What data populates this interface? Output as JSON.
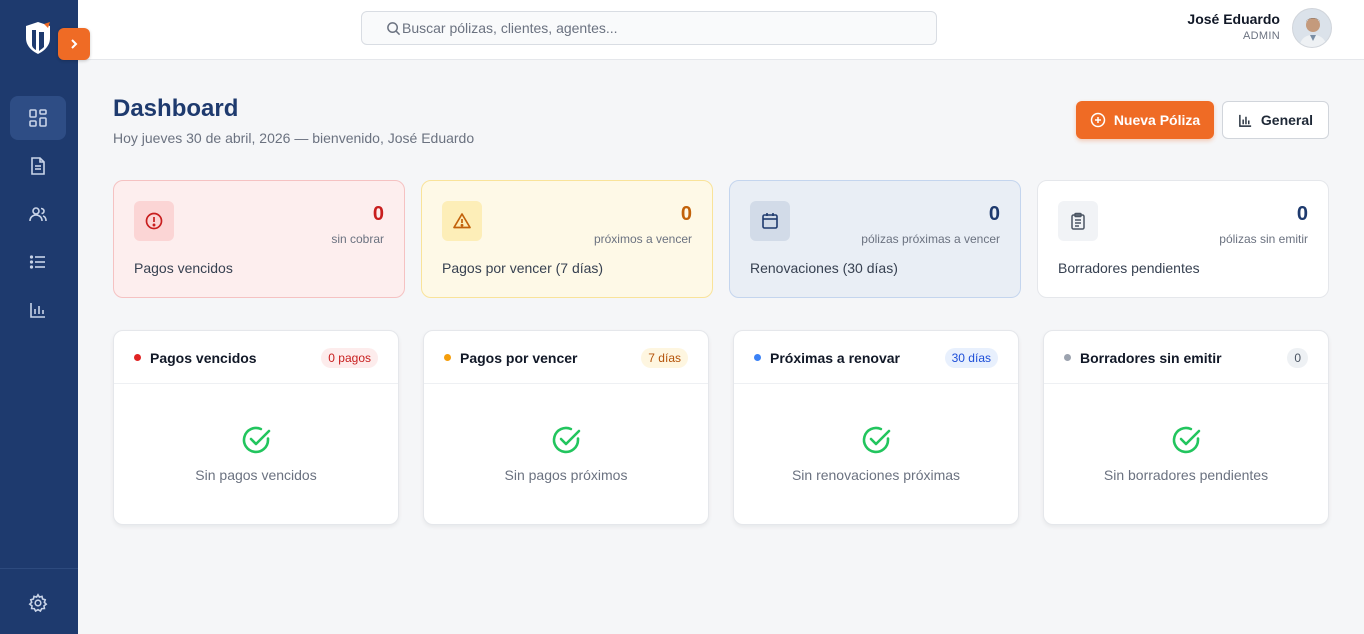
{
  "sidebar": {
    "logo": "shield-logo",
    "items": [
      {
        "icon": "dashboard-grid-icon",
        "active": true
      },
      {
        "icon": "document-icon",
        "active": false
      },
      {
        "icon": "users-icon",
        "active": false
      },
      {
        "icon": "list-icon",
        "active": false
      },
      {
        "icon": "bar-chart-icon",
        "active": false
      }
    ],
    "footer_icon": "gear-icon"
  },
  "header": {
    "search_placeholder": "Buscar pólizas, clientes, agentes...",
    "user_name": "José Eduardo",
    "user_role": "ADMIN"
  },
  "page": {
    "title": "Dashboard",
    "subtitle": "Hoy jueves 30 de abril, 2026 — bienvenido, José Eduardo",
    "primary_button": "Nueva Póliza",
    "secondary_button": "General"
  },
  "stats": [
    {
      "value": "0",
      "sub": "sin cobrar",
      "label": "Pagos vencidos",
      "color": "#c81e1e"
    },
    {
      "value": "0",
      "sub": "próximos a vencer",
      "label": "Pagos por vencer (7 días)",
      "color": "#c2620a"
    },
    {
      "value": "0",
      "sub": "pólizas próximas a vencer",
      "label": "Renovaciones (30 días)",
      "color": "#1e3a6e"
    },
    {
      "value": "0",
      "sub": "pólizas sin emitir",
      "label": "Borradores pendientes",
      "color": "#1e3a6e"
    }
  ],
  "panels": [
    {
      "title": "Pagos vencidos",
      "badge": "0 pagos",
      "empty": "Sin pagos vencidos",
      "dot": "#e02424"
    },
    {
      "title": "Pagos por vencer",
      "badge": "7 días",
      "empty": "Sin pagos próximos",
      "dot": "#f59e0b"
    },
    {
      "title": "Próximas a renovar",
      "badge": "30 días",
      "empty": "Sin renovaciones próximas",
      "dot": "#3b82f6"
    },
    {
      "title": "Borradores sin emitir",
      "badge": "0",
      "empty": "Sin borradores pendientes",
      "dot": "#9ca3af"
    }
  ],
  "colors": {
    "sidebar": "#1e3a6e",
    "accent": "#ef6b25",
    "success": "#22c55e"
  }
}
